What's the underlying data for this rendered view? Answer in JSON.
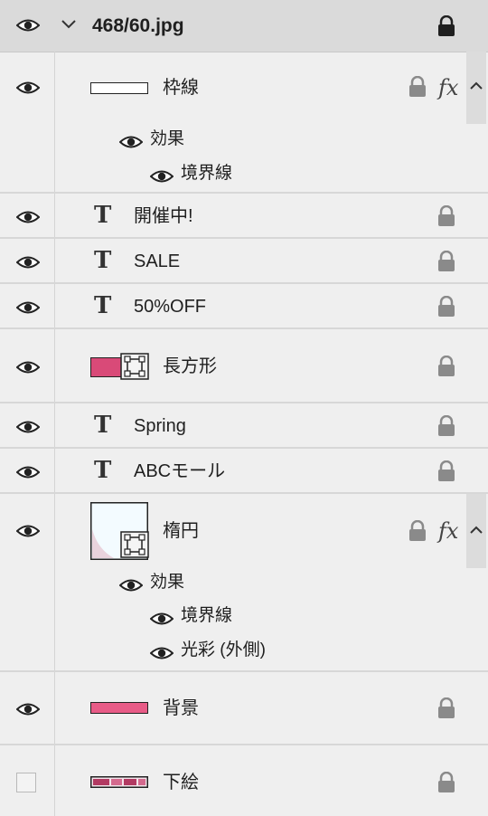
{
  "group": {
    "name": "468/60.jpg"
  },
  "layers": {
    "border": {
      "name": "枠線",
      "effects_label": "効果",
      "effect1": "境界線"
    },
    "t1": {
      "name": "開催中!"
    },
    "t2": {
      "name": "SALE"
    },
    "t3": {
      "name": "50%OFF"
    },
    "rect": {
      "name": "長方形"
    },
    "t4": {
      "name": "Spring"
    },
    "t5": {
      "name": "ABCモール"
    },
    "ellipse": {
      "name": "楕円",
      "effects_label": "効果",
      "effect1": "境界線",
      "effect2": "光彩 (外側)"
    },
    "bg": {
      "name": "背景"
    },
    "sketch": {
      "name": "下絵"
    }
  },
  "icons": {
    "visibility": "eye-icon",
    "lock": "lock-icon",
    "text_layer": "text-layer-icon",
    "fx": "fx",
    "shape_badge": "shape-badge-icon",
    "disclosure": "chevron-down-icon",
    "collapse": "chevron-up-icon"
  },
  "colors": {
    "rect_fill": "#d94a78",
    "bg_fill": "#e85b87",
    "ellipse_thumb": "#f3fbff"
  },
  "fx_label": "fx"
}
